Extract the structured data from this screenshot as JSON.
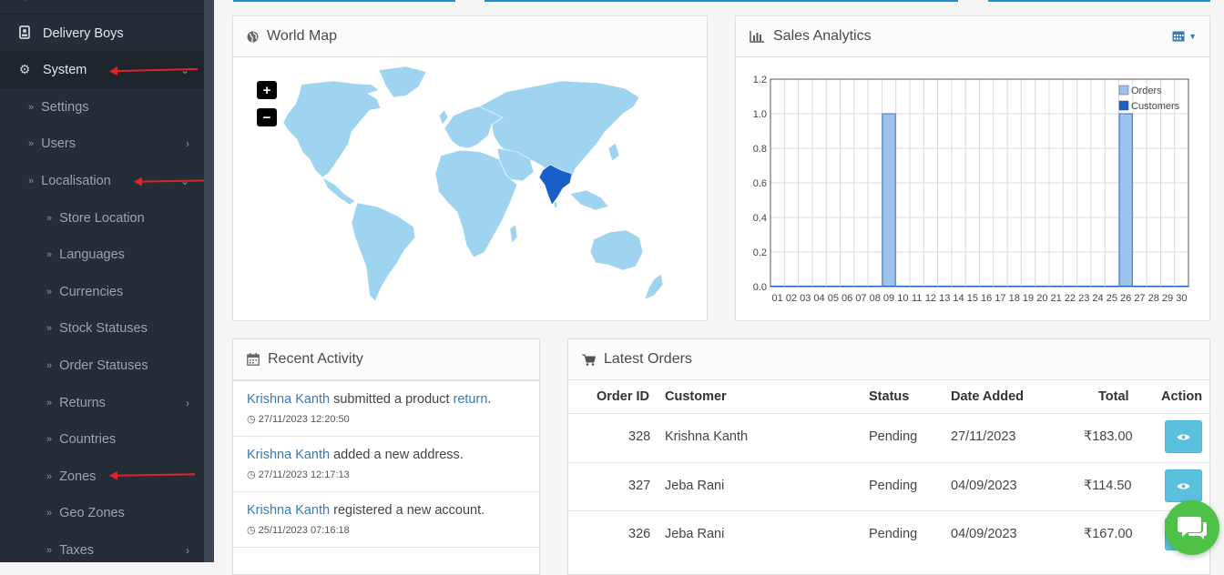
{
  "sidebar": {
    "items": [
      {
        "label": "Delivery Boys",
        "icon": "id-badge-icon",
        "level": 0
      },
      {
        "label": "System",
        "icon": "gear-icon",
        "level": 0,
        "expanded": true
      },
      {
        "label": "Settings",
        "level": 1
      },
      {
        "label": "Users",
        "level": 1,
        "has_children": true
      },
      {
        "label": "Localisation",
        "level": 1,
        "expanded": true
      },
      {
        "label": "Store Location",
        "level": 2
      },
      {
        "label": "Languages",
        "level": 2
      },
      {
        "label": "Currencies",
        "level": 2
      },
      {
        "label": "Stock Statuses",
        "level": 2
      },
      {
        "label": "Order Statuses",
        "level": 2
      },
      {
        "label": "Returns",
        "level": 2,
        "has_children": true
      },
      {
        "label": "Countries",
        "level": 2
      },
      {
        "label": "Zones",
        "level": 2
      },
      {
        "label": "Geo Zones",
        "level": 2
      },
      {
        "label": "Taxes",
        "level": 2,
        "has_children": true
      }
    ]
  },
  "world_map": {
    "title": "World Map",
    "zoom_in": "+",
    "zoom_out": "−",
    "highlight_color": "#1a5fc7",
    "land_color": "#9fd4f0"
  },
  "sales": {
    "title": "Sales Analytics",
    "calendar_icon": "calendar-icon"
  },
  "chart_data": {
    "type": "bar",
    "categories": [
      "01",
      "02",
      "03",
      "04",
      "05",
      "06",
      "07",
      "08",
      "09",
      "10",
      "11",
      "12",
      "13",
      "14",
      "15",
      "16",
      "17",
      "18",
      "19",
      "20",
      "21",
      "22",
      "23",
      "24",
      "25",
      "26",
      "27",
      "28",
      "29",
      "30"
    ],
    "series": [
      {
        "name": "Orders",
        "color": "#9cc2ee",
        "values": [
          0,
          0,
          0,
          0,
          0,
          0,
          0,
          0,
          1,
          0,
          0,
          0,
          0,
          0,
          0,
          0,
          0,
          0,
          0,
          0,
          0,
          0,
          0,
          0,
          0,
          1,
          0,
          0,
          0,
          0
        ]
      },
      {
        "name": "Customers",
        "color": "#1a5fc7",
        "values": [
          0,
          0,
          0,
          0,
          0,
          0,
          0,
          0,
          0,
          0,
          0,
          0,
          0,
          0,
          0,
          0,
          0,
          0,
          0,
          0,
          0,
          0,
          0,
          0,
          0,
          0,
          0,
          0,
          0,
          0
        ]
      }
    ],
    "yticks": [
      "0.0",
      "0.2",
      "0.4",
      "0.6",
      "0.8",
      "1.0",
      "1.2"
    ],
    "ylim": [
      0,
      1.2
    ],
    "grid": true,
    "legend": "top-right"
  },
  "activity": {
    "title": "Recent Activity",
    "items": [
      {
        "user": "Krishna Kanth",
        "text": " submitted a product ",
        "link": "return",
        "end": ".",
        "time": "27/11/2023 12:20:50"
      },
      {
        "user": "Krishna Kanth",
        "text": " added a new address.",
        "link": "",
        "end": "",
        "time": "27/11/2023 12:17:13"
      },
      {
        "user": "Krishna Kanth",
        "text": " registered a new account.",
        "link": "",
        "end": "",
        "time": "25/11/2023 07:16:18"
      },
      {
        "user": "",
        "text": "",
        "link": "",
        "end": "",
        "time": ""
      }
    ]
  },
  "orders": {
    "title": "Latest Orders",
    "headers": {
      "id": "Order ID",
      "customer": "Customer",
      "status": "Status",
      "date": "Date Added",
      "total": "Total",
      "action": "Action"
    },
    "rows": [
      {
        "id": "328",
        "customer": "Krishna Kanth",
        "status": "Pending",
        "date": "27/11/2023",
        "total": "₹183.00"
      },
      {
        "id": "327",
        "customer": "Jeba Rani",
        "status": "Pending",
        "date": "04/09/2023",
        "total": "₹114.50"
      },
      {
        "id": "326",
        "customer": "Jeba Rani",
        "status": "Pending",
        "date": "04/09/2023",
        "total": "₹167.00"
      }
    ]
  }
}
